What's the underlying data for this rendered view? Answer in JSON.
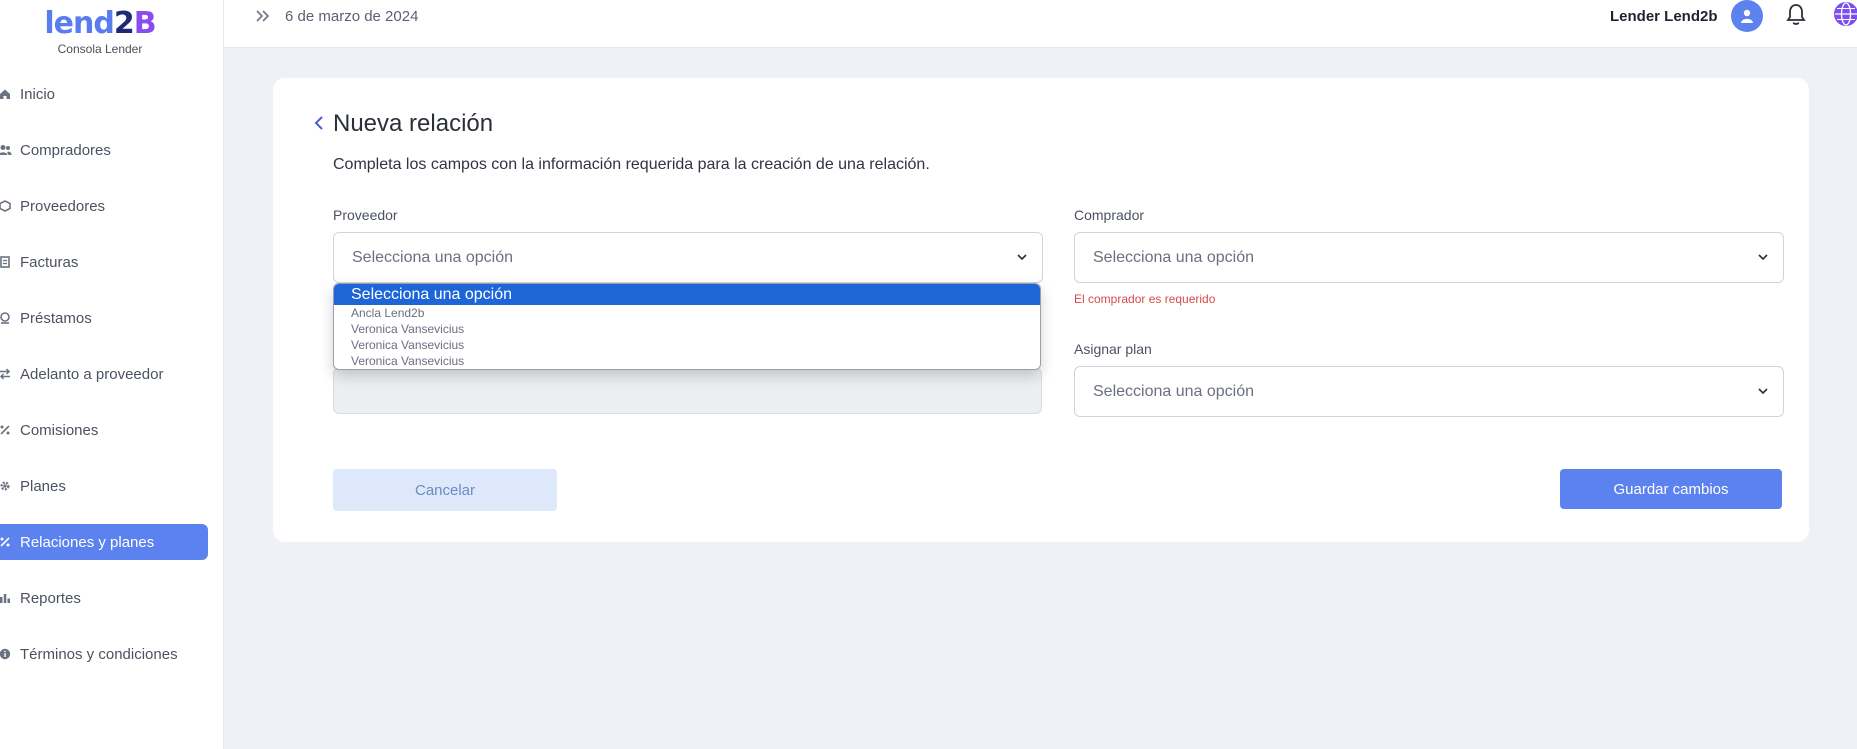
{
  "brand": {
    "name_part1": "lend",
    "name_part2": "2",
    "name_part3": "B",
    "subtitle": "Consola Lender"
  },
  "sidebar": {
    "items": [
      {
        "label": "Inicio",
        "icon": "home-icon"
      },
      {
        "label": "Compradores",
        "icon": "users-icon"
      },
      {
        "label": "Proveedores",
        "icon": "box-icon"
      },
      {
        "label": "Facturas",
        "icon": "invoice-icon"
      },
      {
        "label": "Préstamos",
        "icon": "loan-icon"
      },
      {
        "label": "Adelanto a proveedor",
        "icon": "transfer-icon"
      },
      {
        "label": "Comisiones",
        "icon": "percent-icon"
      },
      {
        "label": "Planes",
        "icon": "gear-icon"
      },
      {
        "label": "Relaciones y planes",
        "icon": "percent-icon",
        "active": true
      },
      {
        "label": "Reportes",
        "icon": "bar-chart-icon"
      },
      {
        "label": "Términos y condiciones",
        "icon": "info-icon"
      }
    ]
  },
  "header": {
    "date": "6 de marzo de 2024",
    "user": "Lender Lend2b"
  },
  "form": {
    "title": "Nueva relación",
    "description": "Completa los campos con la información requerida para la creación de una relación.",
    "proveedor": {
      "label": "Proveedor",
      "value": "Selecciona una opción"
    },
    "comprador": {
      "label": "Comprador",
      "value": "Selecciona una opción",
      "error": "El comprador es requerido"
    },
    "asignar_plan": {
      "label": "Asignar plan",
      "value": "Selecciona una opción"
    },
    "cancel_label": "Cancelar",
    "save_label": "Guardar cambios"
  },
  "dropdown": {
    "options": [
      "Selecciona una opción",
      "Ancla Lend2b",
      "Veronica Vansevicius",
      "Veronica Vansevicius",
      "Veronica Vansevicius"
    ]
  },
  "colors": {
    "accent": "#5b82ef",
    "error": "#d84a4a",
    "selected_option": "#1e66d8"
  }
}
